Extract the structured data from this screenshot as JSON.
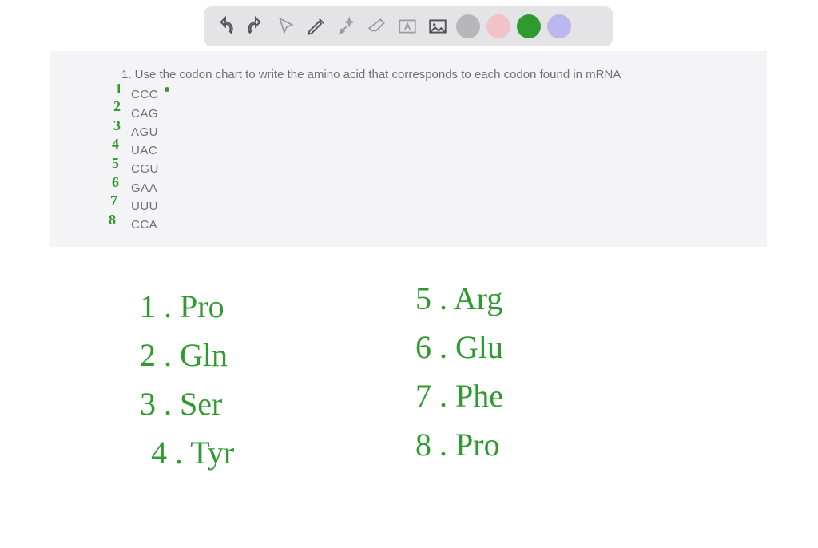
{
  "toolbar": {
    "swatches": {
      "gray": "#b7b7b9",
      "pink": "#f2c3c6",
      "green": "#2f9a2f",
      "lavender": "#b9b9ef"
    }
  },
  "worksheet": {
    "question": "1. Use the codon chart to write the amino acid that corresponds to each codon found in mRNA",
    "codons": [
      "CCC",
      "CAG",
      "AGU",
      "UAC",
      "CGU",
      "GAA",
      "UUU",
      "CCA"
    ],
    "hand_numbers": [
      "1",
      "2",
      "3",
      "4",
      "5",
      "6",
      "7",
      "8"
    ]
  },
  "answers": {
    "left": [
      "1 . Pro",
      "2 . Gln",
      "3 . Ser",
      "4 . Tyr"
    ],
    "right": [
      "5 . Arg",
      "6 . Glu",
      "7 . Phe",
      "8 . Pro"
    ]
  }
}
